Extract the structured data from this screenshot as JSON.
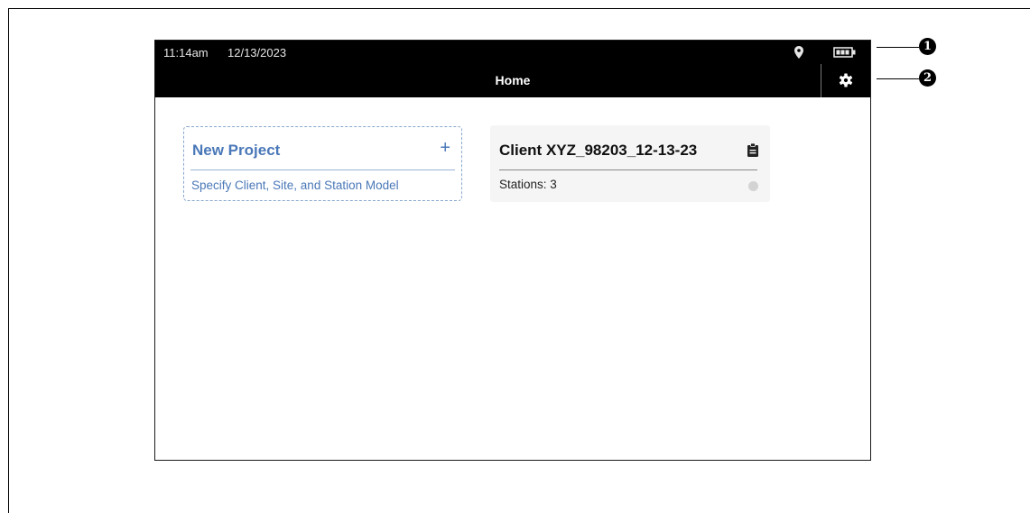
{
  "status_bar": {
    "time": "11:14am",
    "date": "12/13/2023",
    "location_icon": "location-pin-icon",
    "battery_icon": "battery-icon"
  },
  "header": {
    "title": "Home",
    "settings_icon": "gear-icon"
  },
  "new_project_card": {
    "title": "New Project",
    "plus": "+",
    "subtitle": "Specify Client, Site, and Station Model"
  },
  "project_card": {
    "title": "Client XYZ_98203_12-13-23",
    "stations": "Stations: 3",
    "icon": "clipboard-icon"
  },
  "callouts": [
    "1",
    "2"
  ],
  "colors": {
    "accent": "#4a78b8",
    "bar": "#000000",
    "card_bg": "#f5f5f5"
  }
}
